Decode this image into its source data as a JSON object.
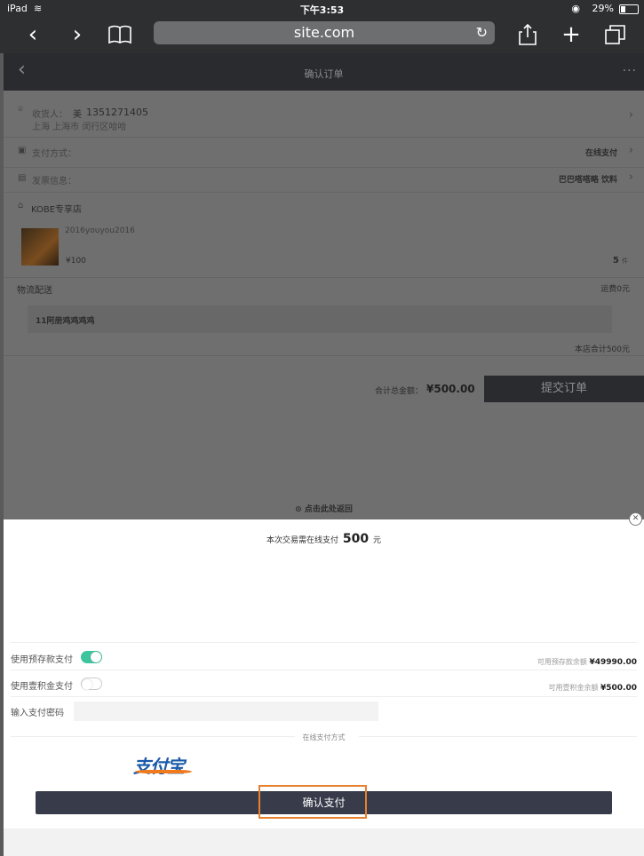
{
  "statusbar": {
    "device": "iPad",
    "time": "下午3:53",
    "battery": "29%",
    "battery_level": 0.29
  },
  "safari": {
    "url": "site.com"
  },
  "page": {
    "title": "确认订单",
    "consignee_label": "收货人：",
    "consignee_name": "美",
    "consignee_phone": "1351271405",
    "consignee_address": "上海 上海市 闵行区哈哈",
    "payment_label": "支付方式：",
    "payment_value": "在线支付",
    "invoice_label": "发票信息：",
    "invoice_value": "巴巴嗒嗒略 饮料",
    "store_name": "KOBE专享店",
    "product_name": "2016youyou2016",
    "product_price": "¥100",
    "product_qty": "5",
    "product_qty_unit": "件",
    "shipping_label": "物流配送",
    "shipping_fee": "运费0元",
    "remark": "11阿册鸡鸡鸡鸡",
    "store_total": "本店合计500元",
    "grand_total_label": "合计总金额：",
    "grand_total": "¥500.00",
    "submit_label": "提交订单",
    "tap_back": "点击此处返回"
  },
  "sheet": {
    "need_prefix": "本次交易需在线支付",
    "need_amount": "500",
    "need_unit": "元",
    "deposit_label": "使用预存款支付",
    "deposit_available_label": "可用预存款余额",
    "deposit_available_value": "¥49990.00",
    "deposit_enabled": true,
    "gold_label": "使用壹积金支付",
    "gold_available_label": "可用壹积金余额",
    "gold_available_value": "¥500.00",
    "gold_enabled": false,
    "password_label": "输入支付密码",
    "password_placeholder": "",
    "online_methods_title": "在线支付方式",
    "alipay_logo_text": "支付宝",
    "confirm_label": "确认支付",
    "highlight_color": "#e8812e",
    "toggle_on_color": "#3fc59d"
  }
}
